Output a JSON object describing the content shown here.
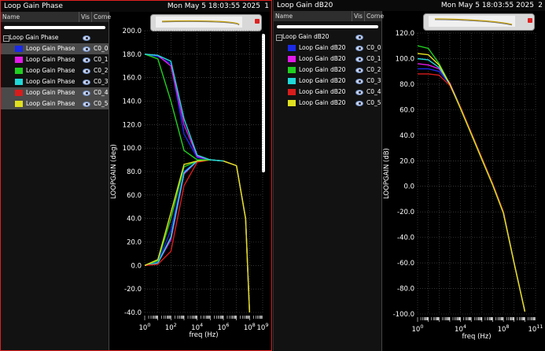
{
  "panes": [
    {
      "title": "Loop Gain Phase",
      "datetime": "Mon May 5 18:03:55 2025",
      "number": "1",
      "headers": {
        "name": "Name",
        "vis": "Vis",
        "corner": "Corne"
      },
      "root": "Loop Gain Phase",
      "items": [
        {
          "label": "Loop Gain Phase",
          "corner": "C0_0",
          "color": "#1a2ae8"
        },
        {
          "label": "Loop Gain Phase",
          "corner": "C0_1",
          "color": "#e21ae8"
        },
        {
          "label": "Loop Gain Phase",
          "corner": "C0_2",
          "color": "#20d020"
        },
        {
          "label": "Loop Gain Phase",
          "corner": "C0_3",
          "color": "#20d8d8"
        },
        {
          "label": "Loop Gain Phase",
          "corner": "C0_4",
          "color": "#d81c1c"
        },
        {
          "label": "Loop Gain Phase",
          "corner": "C0_5",
          "color": "#e0e020"
        }
      ],
      "chart": {
        "ylabel": "LOOPGAIN (deg)",
        "xlabel": "freq (Hz)",
        "yticks": [
          "200.0",
          "180.0",
          "160.0",
          "140.0",
          "120.0",
          "100.0",
          "80.0",
          "60.0",
          "40.0",
          "20.0",
          "0.0",
          "-20.0",
          "-40.0"
        ]
      }
    },
    {
      "title": "Loop Gain dB20",
      "datetime": "Mon May 5 18:03:55 2025",
      "number": "2",
      "headers": {
        "name": "Name",
        "vis": "Vis",
        "corner": "Corne"
      },
      "root": "Loop Gain dB20",
      "items": [
        {
          "label": "Loop Gain dB20",
          "corner": "C0_0",
          "color": "#1a2ae8"
        },
        {
          "label": "Loop Gain dB20",
          "corner": "C0_1",
          "color": "#e21ae8"
        },
        {
          "label": "Loop Gain dB20",
          "corner": "C0_2",
          "color": "#20d020"
        },
        {
          "label": "Loop Gain dB20",
          "corner": "C0_3",
          "color": "#20d8d8"
        },
        {
          "label": "Loop Gain dB20",
          "corner": "C0_4",
          "color": "#d81c1c"
        },
        {
          "label": "Loop Gain dB20",
          "corner": "C0_5",
          "color": "#e0e020"
        }
      ],
      "chart": {
        "ylabel": "LOOPGAIN (dB)",
        "xlabel": "freq (Hz)",
        "yticks": [
          "120.0",
          "100.0",
          "80.0",
          "60.0",
          "40.0",
          "20.0",
          "0.0",
          "-20.0",
          "-40.0",
          "-60.0",
          "-80.0",
          "-100.0"
        ]
      }
    }
  ],
  "chart_data": [
    {
      "type": "line",
      "title": "Loop Gain Phase",
      "xlabel": "freq (Hz)",
      "ylabel": "LOOPGAIN (deg)",
      "xscale": "log",
      "xlim": [
        1,
        1000000000
      ],
      "ylim": [
        -40,
        200
      ],
      "xticks": [
        "10^0",
        "10^2",
        "10^4",
        "10^6",
        "10^8",
        "10^9"
      ],
      "grid": true,
      "series": [
        {
          "name": "C0_0",
          "color": "#1a2ae8",
          "x": [
            1,
            10,
            100,
            1000,
            10000,
            100000,
            1000000,
            10000000,
            50000000,
            100000000
          ],
          "y": [
            0,
            3,
            30,
            80,
            89,
            90,
            89,
            85,
            40,
            -40
          ]
        },
        {
          "name": "C0_1",
          "color": "#e21ae8",
          "x": [
            1,
            10,
            100,
            1000,
            10000,
            100000,
            1000000,
            10000000,
            50000000,
            100000000
          ],
          "y": [
            0,
            2,
            22,
            78,
            89,
            90,
            89,
            85,
            40,
            -40
          ]
        },
        {
          "name": "C0_2",
          "color": "#20d020",
          "x": [
            1,
            10,
            100,
            1000,
            10000,
            100000,
            1000000,
            10000000,
            50000000,
            100000000
          ],
          "y": [
            0,
            4,
            40,
            84,
            89,
            90,
            89,
            85,
            40,
            -40
          ]
        },
        {
          "name": "C0_3",
          "color": "#20d8d8",
          "x": [
            1,
            10,
            100,
            1000,
            10000,
            100000,
            1000000,
            10000000,
            50000000,
            100000000
          ],
          "y": [
            0,
            2,
            24,
            79,
            89,
            90,
            89,
            85,
            40,
            -40
          ]
        },
        {
          "name": "C0_4",
          "color": "#d81c1c",
          "x": [
            1,
            10,
            100,
            1000,
            10000,
            100000,
            1000000,
            10000000,
            50000000,
            100000000
          ],
          "y": [
            0,
            1,
            12,
            68,
            88,
            90,
            89,
            85,
            40,
            -40
          ]
        },
        {
          "name": "C0_5",
          "color": "#e0e020",
          "x": [
            1,
            10,
            100,
            1000,
            10000,
            100000,
            1000000,
            10000000,
            50000000,
            100000000
          ],
          "y": [
            0,
            5,
            45,
            86,
            89,
            90,
            89,
            85,
            40,
            -40
          ]
        },
        {
          "name": "C0_0",
          "color": "#1a2ae8",
          "x": [
            1,
            10,
            100,
            1000,
            10000,
            100000,
            1000000
          ],
          "y": [
            180,
            178,
            172,
            112,
            92,
            90,
            89
          ]
        },
        {
          "name": "C0_1",
          "color": "#e21ae8",
          "x": [
            1,
            10,
            100,
            1000,
            10000,
            100000,
            1000000
          ],
          "y": [
            180,
            179,
            170,
            120,
            93,
            90,
            89
          ]
        },
        {
          "name": "C0_2",
          "color": "#20d020",
          "x": [
            1,
            10,
            100,
            1000,
            10000,
            100000,
            1000000
          ],
          "y": [
            180,
            176,
            140,
            98,
            90,
            90,
            89
          ]
        },
        {
          "name": "C0_3",
          "color": "#20d8d8",
          "x": [
            1,
            10,
            100,
            1000,
            10000,
            100000,
            1000000
          ],
          "y": [
            180,
            179,
            174,
            125,
            94,
            90,
            89
          ]
        }
      ]
    },
    {
      "type": "line",
      "title": "Loop Gain dB20",
      "xlabel": "freq (Hz)",
      "ylabel": "LOOPGAIN (dB)",
      "xscale": "log",
      "xlim": [
        1,
        100000000000
      ],
      "ylim": [
        -100,
        120
      ],
      "xticks": [
        "10^0",
        "10^4",
        "10^8",
        "10^11"
      ],
      "grid": true,
      "series": [
        {
          "name": "C0_0",
          "color": "#1a2ae8",
          "x": [
            1,
            10,
            100,
            1000,
            10000,
            100000,
            1000000,
            10000000,
            100000000,
            1000000000,
            10000000000
          ],
          "y": [
            92,
            92,
            90,
            80,
            62,
            42,
            22,
            2,
            -20,
            -60,
            -98
          ]
        },
        {
          "name": "C0_1",
          "color": "#e21ae8",
          "x": [
            1,
            10,
            100,
            1000,
            10000,
            100000,
            1000000,
            10000000,
            100000000,
            1000000000,
            10000000000
          ],
          "y": [
            96,
            95,
            92,
            81,
            62,
            42,
            22,
            2,
            -20,
            -60,
            -98
          ]
        },
        {
          "name": "C0_2",
          "color": "#20d020",
          "x": [
            1,
            10,
            100,
            1000,
            10000,
            100000,
            1000000,
            10000000,
            100000000,
            1000000000,
            10000000000
          ],
          "y": [
            110,
            108,
            96,
            80,
            61,
            41,
            21,
            1,
            -21,
            -60,
            -98
          ]
        },
        {
          "name": "C0_3",
          "color": "#20d8d8",
          "x": [
            1,
            10,
            100,
            1000,
            10000,
            100000,
            1000000,
            10000000,
            100000000,
            1000000000,
            10000000000
          ],
          "y": [
            100,
            99,
            93,
            80,
            62,
            42,
            22,
            2,
            -20,
            -60,
            -98
          ]
        },
        {
          "name": "C0_4",
          "color": "#d81c1c",
          "x": [
            1,
            10,
            100,
            1000,
            10000,
            100000,
            1000000,
            10000000,
            100000000,
            1000000000,
            10000000000
          ],
          "y": [
            88,
            88,
            87,
            79,
            62,
            42,
            22,
            2,
            -20,
            -60,
            -98
          ]
        },
        {
          "name": "C0_5",
          "color": "#e0e020",
          "x": [
            1,
            10,
            100,
            1000,
            10000,
            100000,
            1000000,
            10000000,
            100000000,
            1000000000,
            10000000000
          ],
          "y": [
            104,
            103,
            95,
            80,
            61,
            41,
            21,
            1,
            -21,
            -60,
            -98
          ]
        }
      ]
    }
  ]
}
